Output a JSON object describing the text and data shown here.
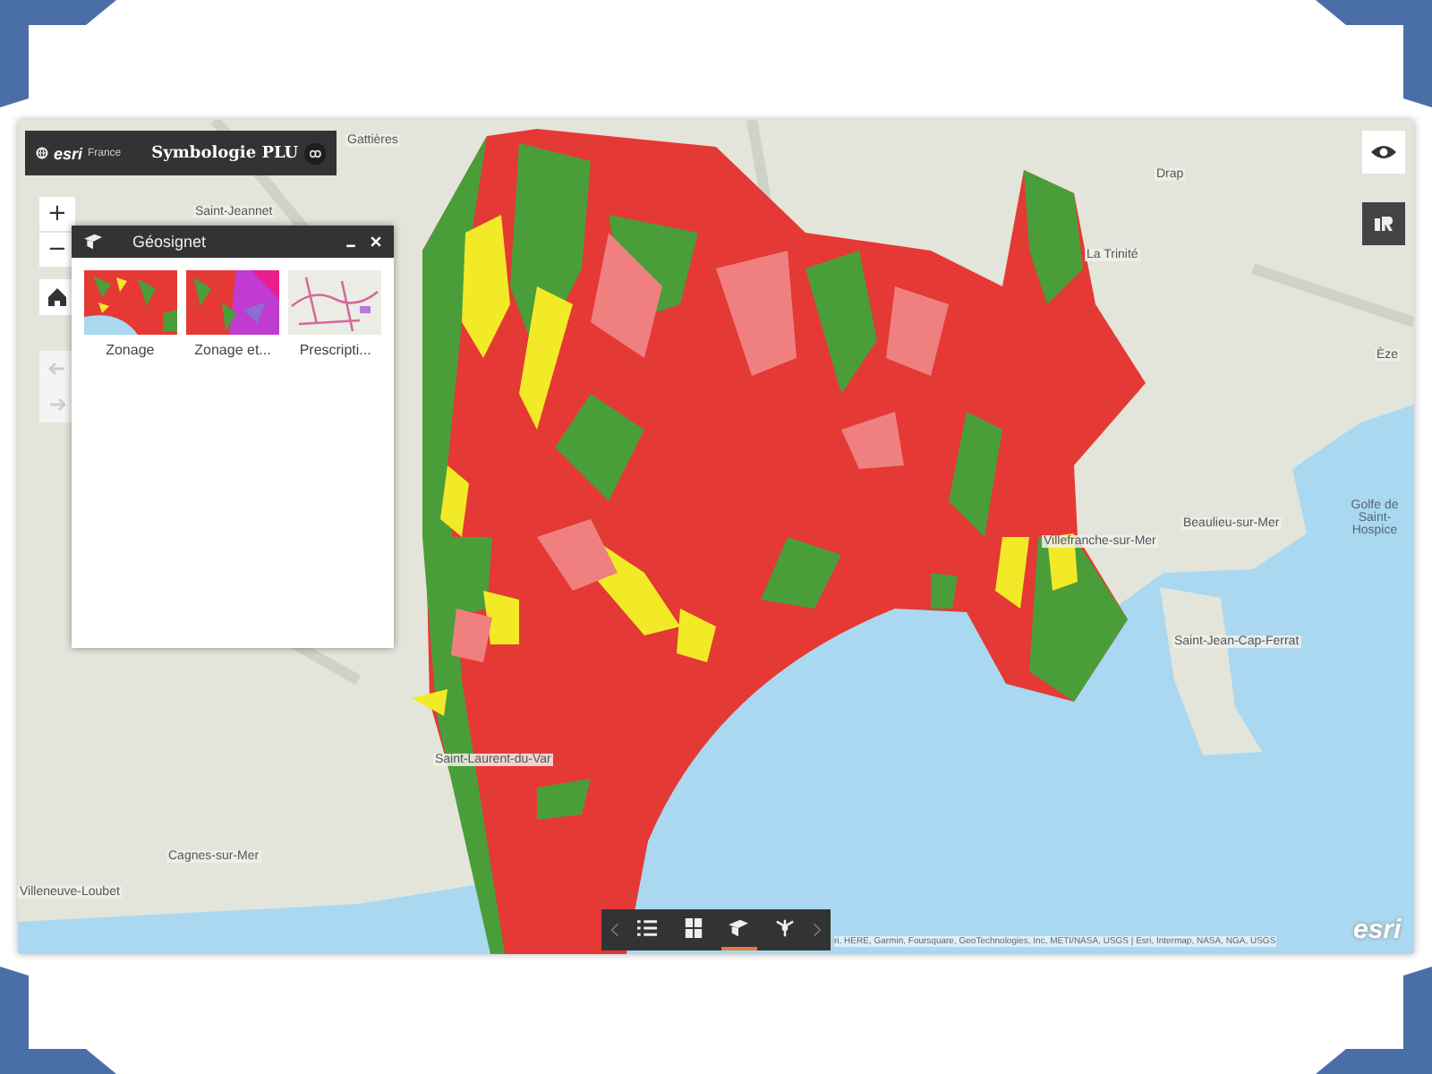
{
  "header": {
    "logo_text": "esri",
    "logo_sub": "France",
    "title": "Symbologie PLU"
  },
  "map_controls": {
    "zoom_in": "+",
    "zoom_out": "−"
  },
  "bookmark_panel": {
    "title": "Géosignet",
    "items": [
      {
        "label": "Zonage",
        "kind": "zoning"
      },
      {
        "label": "Zonage et...",
        "kind": "zoning-purple"
      },
      {
        "label": "Prescripti...",
        "kind": "prescriptions"
      }
    ]
  },
  "place_labels": [
    {
      "name": "Gattières"
    },
    {
      "name": "Saint-Jeannet"
    },
    {
      "name": "Drap"
    },
    {
      "name": "La Trinité"
    },
    {
      "name": "Èze"
    },
    {
      "name": "Villefranche-sur-Mer"
    },
    {
      "name": "Beaulieu-sur-Mer"
    },
    {
      "name": "Golfe de Saint-Hospice"
    },
    {
      "name": "Saint-Jean-Cap-Ferrat"
    },
    {
      "name": "Saint-Laurent-du-Var"
    },
    {
      "name": "Cagnes-sur-Mer"
    },
    {
      "name": "Villeneuve-Loubet"
    }
  ],
  "toolbar": {
    "items": [
      {
        "kind": "list",
        "selected": false
      },
      {
        "kind": "grid",
        "selected": false
      },
      {
        "kind": "bookmark",
        "selected": true
      },
      {
        "kind": "tree",
        "selected": false
      }
    ]
  },
  "attribution": "ri, HERE, Garmin, Foursquare, GeoTechnologies, Inc, METI/NASA, USGS | Esri, Intermap, NASA, NGA, USGS",
  "footer_logo": "esri"
}
